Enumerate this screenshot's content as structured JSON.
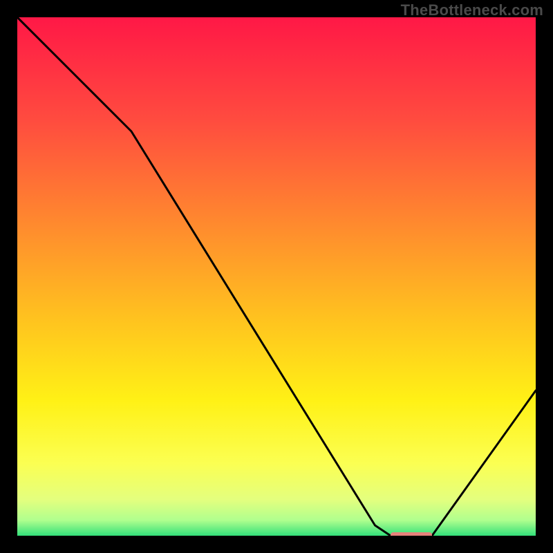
{
  "watermark": "TheBottleneck.com",
  "chart_data": {
    "type": "line",
    "title": "",
    "xlabel": "",
    "ylabel": "",
    "ylim": [
      0,
      100
    ],
    "xlim": [
      0,
      100
    ],
    "x": [
      0,
      13,
      22,
      69,
      72,
      80,
      100
    ],
    "values": [
      100,
      87,
      78,
      2,
      0,
      0,
      28
    ],
    "marker": {
      "x_start": 72,
      "x_end": 80,
      "y": 0,
      "color": "#e6827b"
    },
    "gradient_stops": [
      {
        "offset": 0.0,
        "color": "#ff1846"
      },
      {
        "offset": 0.2,
        "color": "#ff4c3f"
      },
      {
        "offset": 0.4,
        "color": "#ff8a2e"
      },
      {
        "offset": 0.58,
        "color": "#ffc21f"
      },
      {
        "offset": 0.74,
        "color": "#fff116"
      },
      {
        "offset": 0.86,
        "color": "#fbff52"
      },
      {
        "offset": 0.93,
        "color": "#e4ff7e"
      },
      {
        "offset": 0.97,
        "color": "#b0ff8e"
      },
      {
        "offset": 1.0,
        "color": "#33e07a"
      }
    ],
    "curve_color": "#000000",
    "curve_width": 3
  }
}
